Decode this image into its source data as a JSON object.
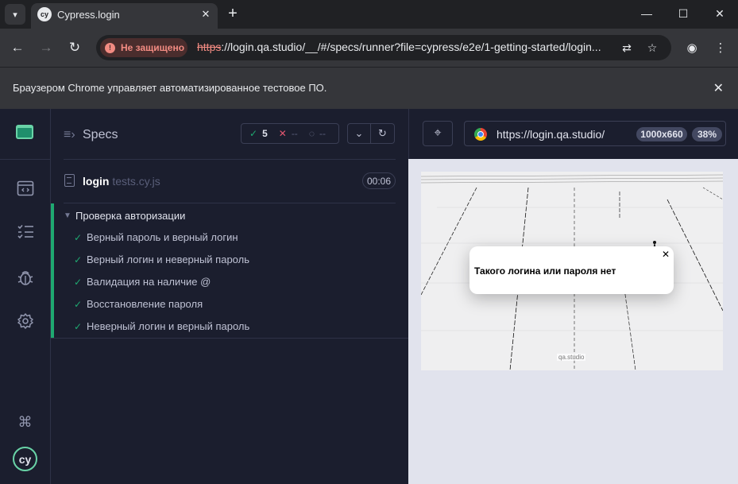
{
  "browser": {
    "tab_title": "Cypress.login",
    "tab_favicon": "cy",
    "security_label": "Не защищено",
    "url_scheme": "https",
    "url_rest": "://login.qa.studio/__/#/specs/runner?file=cypress/e2e/1-getting-started/login...",
    "infobar_text": "Браузером Chrome управляет автоматизированное тестовое ПО.",
    "icons": {
      "tab_menu": "chevron-down-icon",
      "tab_close": "close-icon",
      "new_tab": "plus-icon",
      "minimize": "minimize-icon",
      "maximize": "maximize-icon",
      "close": "close-icon",
      "back": "back-icon",
      "forward": "forward-icon",
      "reload": "reload-icon",
      "translate": "translate-icon",
      "bookmark": "star-icon",
      "profile": "profile-icon",
      "menu": "kebab-menu-icon"
    }
  },
  "cypress": {
    "sidenav": {
      "items": [
        "runs-icon",
        "specs-icon",
        "debug-icon",
        "settings-icon"
      ],
      "shortcut_icon": "command-icon",
      "logo": "cy"
    },
    "specs": {
      "title": "Specs",
      "passed": "5",
      "failed": "--",
      "pending": "--"
    },
    "spec_file": {
      "base": "login",
      "ext": " tests.cy.js",
      "duration": "00:06"
    },
    "suite": {
      "title": "Проверка авторизации",
      "tests": [
        "Верный пароль и верный логин",
        "Верный логин и неверный пароль",
        "Валидация на наличие @",
        "Восстановление пароля",
        "Неверный логин и верный пароль"
      ]
    },
    "runner": {
      "aut_url": "https://login.qa.studio/",
      "viewport": "1000x660",
      "scale": "38%"
    },
    "aut": {
      "modal_message": "Такого логина или пароля нет",
      "watermark": "qa.studio"
    },
    "colors": {
      "pass": "#1fa971",
      "fail": "#e45770",
      "accent": "#69d3a7"
    }
  }
}
